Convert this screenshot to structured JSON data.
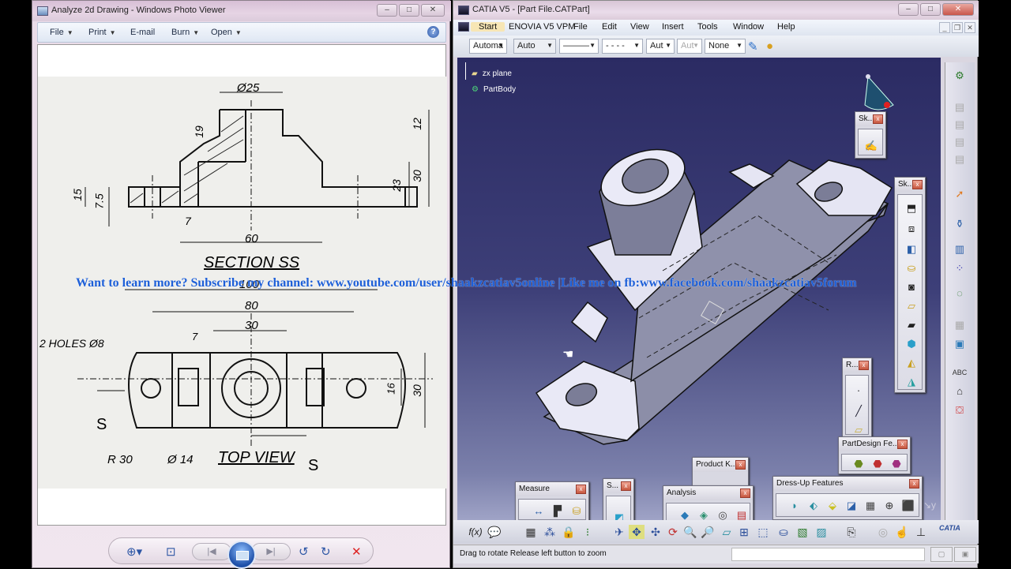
{
  "photo_viewer": {
    "title": "Analyze 2d Drawing - Windows Photo Viewer",
    "window_controls": {
      "minimize": "–",
      "maximize": "□",
      "close": "✕"
    },
    "menu": [
      {
        "label": "File",
        "has_dropdown": true
      },
      {
        "label": "Print",
        "has_dropdown": true
      },
      {
        "label": "E-mail",
        "has_dropdown": false
      },
      {
        "label": "Burn",
        "has_dropdown": true
      },
      {
        "label": "Open",
        "has_dropdown": true
      }
    ],
    "help_icon": "?",
    "drawing": {
      "section_title": "SECTION SS",
      "top_title": "TOP VIEW",
      "section_dims": [
        "Ø25",
        "19",
        "12",
        "30",
        "23",
        "15",
        "7.5",
        "7",
        "60"
      ],
      "top_dims": [
        "100",
        "80",
        "30",
        "7",
        "16",
        "30"
      ],
      "callouts": {
        "holes": "2 HOLES Ø8",
        "radius": "R 30",
        "diameter": "Ø 14",
        "section_mark": "S"
      }
    },
    "nav_controls": [
      "zoom",
      "actual-size",
      "previous",
      "slideshow",
      "next",
      "rotate-ccw",
      "rotate-cw",
      "delete"
    ]
  },
  "catia": {
    "title": "CATIA V5 - [Part File.CATPart]",
    "window_controls": {
      "minimize": "–",
      "maximize": "□",
      "close": "✕"
    },
    "menu": [
      "Start",
      "ENOVIA V5 VPM",
      "File",
      "Edit",
      "View",
      "Insert",
      "Tools",
      "Window",
      "Help"
    ],
    "mdi_controls": [
      "_",
      "❐",
      "✕"
    ],
    "graphic_properties": {
      "color": "Automa",
      "transparency": "Auto",
      "line_thickness": "———",
      "line_type": "- - - -",
      "point_type": "Aut",
      "layer_disabled": "Aut",
      "layer": "None"
    },
    "tree": [
      {
        "label": "zx plane",
        "icon": "plane-icon"
      },
      {
        "label": "PartBody",
        "icon": "partbody-icon"
      }
    ],
    "palettes": {
      "sketch_small": {
        "title": "Sk..."
      },
      "sketch_based": {
        "title": "Sk..."
      },
      "reference": {
        "title": "R..."
      },
      "partdesign_features": {
        "title": "PartDesign Fe..."
      },
      "product_knowledge": {
        "title": "Product K..."
      },
      "measure": {
        "title": "Measure"
      },
      "surface": {
        "title": "S..."
      },
      "analysis": {
        "title": "Analysis"
      },
      "dressup": {
        "title": "Dress-Up Features"
      }
    },
    "status_text": "Drag to rotate  Release left button to zoom",
    "command_input": "",
    "logo": "CATIA"
  },
  "overlay_text": "Want to learn more? Subscribe my channel: www.youtube.com/user/shaakzcatiav5online |Like me on fb:www.facebook.com/shaakzcatiav5forum"
}
